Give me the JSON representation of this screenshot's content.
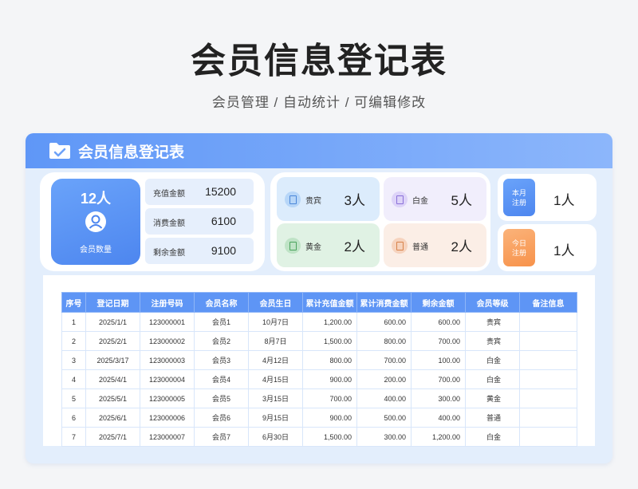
{
  "page": {
    "title": "会员信息登记表",
    "subtitle": "会员管理 / 自动统计 /  可编辑修改"
  },
  "card": {
    "title": "会员信息登记表",
    "icon": "folder-check-icon"
  },
  "summary": {
    "member_count": "12人",
    "member_count_label": "会员数量",
    "recharge_label": "充值金额",
    "recharge_value": "15200",
    "consume_label": "消费金额",
    "consume_value": "6100",
    "remaining_label": "剩余金额",
    "remaining_value": "9100"
  },
  "levels": [
    {
      "label": "贵宾",
      "count": "3人",
      "color": "#dcecfc"
    },
    {
      "label": "白金",
      "count": "5人",
      "color": "#f1eefc"
    },
    {
      "label": "黄金",
      "count": "2人",
      "color": "#e0f2e4"
    },
    {
      "label": "普通",
      "count": "2人",
      "color": "#fbeee6"
    }
  ],
  "time_stats": {
    "month_label_1": "本月",
    "month_label_2": "注册",
    "month_value": "1人",
    "today_label_1": "今日",
    "today_label_2": "注册",
    "today_value": "1人"
  },
  "table": {
    "headers": [
      "序号",
      "登记日期",
      "注册号码",
      "会员名称",
      "会员生日",
      "累计充值金额",
      "累计消费金额",
      "剩余金额",
      "会员等级",
      "备注信息"
    ],
    "rows": [
      [
        "1",
        "2025/1/1",
        "123000001",
        "会员1",
        "10月7日",
        "1,200.00",
        "600.00",
        "600.00",
        "贵宾",
        ""
      ],
      [
        "2",
        "2025/2/1",
        "123000002",
        "会员2",
        "8月7日",
        "1,500.00",
        "800.00",
        "700.00",
        "贵宾",
        ""
      ],
      [
        "3",
        "2025/3/17",
        "123000003",
        "会员3",
        "4月12日",
        "800.00",
        "700.00",
        "100.00",
        "白金",
        ""
      ],
      [
        "4",
        "2025/4/1",
        "123000004",
        "会员4",
        "4月15日",
        "900.00",
        "200.00",
        "700.00",
        "白金",
        ""
      ],
      [
        "5",
        "2025/5/1",
        "123000005",
        "会员5",
        "3月15日",
        "700.00",
        "400.00",
        "300.00",
        "黄金",
        ""
      ],
      [
        "6",
        "2025/6/1",
        "123000006",
        "会员6",
        "9月15日",
        "900.00",
        "500.00",
        "400.00",
        "普通",
        ""
      ],
      [
        "7",
        "2025/7/1",
        "123000007",
        "会员7",
        "6月30日",
        "1,500.00",
        "300.00",
        "1,200.00",
        "白金",
        ""
      ]
    ]
  },
  "colors": {
    "accent": "#5e95f5",
    "orange": "#f9a05a"
  }
}
